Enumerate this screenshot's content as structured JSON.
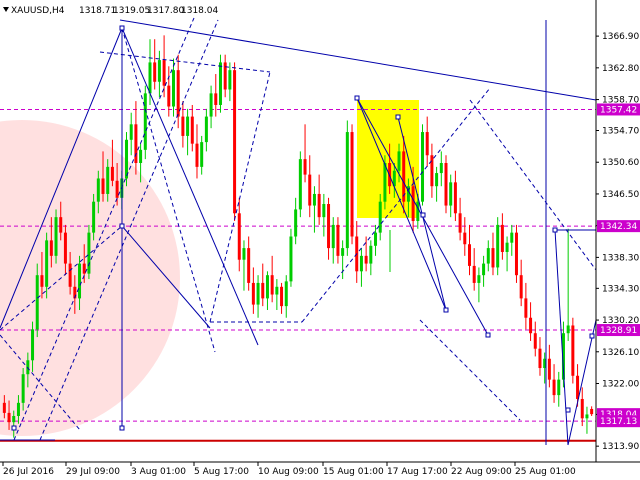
{
  "chart_data": {
    "type": "candlestick",
    "header": {
      "symbol": "XAUUSD,H4",
      "open": "1318.71",
      "high": "1319.05",
      "low": "1317.80",
      "close": "1318.04"
    },
    "ylim": [
      1312.5,
      1369.5
    ],
    "y_ticks": [
      "1366.90",
      "1362.80",
      "1358.70",
      "1354.70",
      "1350.60",
      "1346.50",
      "1342.40",
      "1338.30",
      "1334.30",
      "1330.20",
      "1326.10",
      "1322.00",
      "1318.00",
      "1313.90"
    ],
    "x_ticks": [
      "26 Jul 2016",
      "29 Jul 09:00",
      "3 Aug 01:00",
      "5 Aug 17:00",
      "10 Aug 09:00",
      "15 Aug 01:00",
      "17 Aug 17:00",
      "22 Aug 09:00",
      "25 Aug 01:00"
    ],
    "price_labels": [
      {
        "text": "1357.42",
        "value": 1357.42
      },
      {
        "text": "1342.34",
        "value": 1342.34
      },
      {
        "text": "1328.91",
        "value": 1328.91
      },
      {
        "text": "1318.04",
        "value": 1318.04
      },
      {
        "text": "1317.13",
        "value": 1317.13
      }
    ],
    "levels": [
      {
        "value": 1357.42,
        "color": "#cc00cc",
        "style": "dashed"
      },
      {
        "value": 1342.34,
        "color": "#cc00cc",
        "style": "dashed"
      },
      {
        "value": 1328.91,
        "color": "#cc00cc",
        "style": "dashed"
      },
      {
        "value": 1317.13,
        "color": "#cc00cc",
        "style": "dashed"
      },
      {
        "value": 1314.6,
        "color": "#cc0000",
        "style": "solid"
      }
    ],
    "colors": {
      "bull": "#00cc00",
      "bear": "#ff0000",
      "trend": "#0000aa",
      "fan": "#0000cc",
      "level": "#cc00cc",
      "highlight": "#ffff00",
      "circle": "#ffd6d6"
    },
    "candles": [
      [
        1319.5,
        1320.5,
        1317.5,
        1318.2
      ],
      [
        1318.2,
        1319.8,
        1316.0,
        1317.0
      ],
      [
        1317.0,
        1318.5,
        1315.0,
        1317.8
      ],
      [
        1317.8,
        1320.5,
        1316.8,
        1319.5
      ],
      [
        1319.5,
        1324.0,
        1318.5,
        1323.2
      ],
      [
        1323.2,
        1326.0,
        1321.5,
        1325.0
      ],
      [
        1325.0,
        1330.0,
        1323.5,
        1329.0
      ],
      [
        1329.0,
        1337.5,
        1328.0,
        1336.0
      ],
      [
        1336.0,
        1339.0,
        1333.0,
        1334.5
      ],
      [
        1334.5,
        1341.5,
        1333.0,
        1340.5
      ],
      [
        1340.5,
        1343.5,
        1337.0,
        1338.5
      ],
      [
        1338.5,
        1344.5,
        1337.5,
        1343.5
      ],
      [
        1343.5,
        1345.5,
        1340.5,
        1341.5
      ],
      [
        1341.5,
        1342.5,
        1336.0,
        1337.5
      ],
      [
        1337.5,
        1339.0,
        1333.5,
        1334.5
      ],
      [
        1334.5,
        1336.0,
        1331.0,
        1333.0
      ],
      [
        1333.0,
        1338.5,
        1331.5,
        1337.5
      ],
      [
        1337.5,
        1340.0,
        1335.0,
        1336.2
      ],
      [
        1336.2,
        1342.5,
        1335.5,
        1341.5
      ],
      [
        1341.5,
        1346.5,
        1340.5,
        1345.5
      ],
      [
        1345.5,
        1349.5,
        1344.0,
        1348.5
      ],
      [
        1348.5,
        1352.0,
        1345.5,
        1346.5
      ],
      [
        1346.5,
        1351.0,
        1345.5,
        1350.0
      ],
      [
        1350.0,
        1353.5,
        1347.5,
        1348.2
      ],
      [
        1348.2,
        1350.5,
        1345.0,
        1346.0
      ],
      [
        1346.0,
        1349.5,
        1344.5,
        1348.5
      ],
      [
        1348.5,
        1354.5,
        1347.5,
        1353.5
      ],
      [
        1353.5,
        1357.0,
        1351.5,
        1355.5
      ],
      [
        1355.5,
        1358.5,
        1349.0,
        1350.5
      ],
      [
        1350.5,
        1353.0,
        1348.0,
        1352.2
      ],
      [
        1352.2,
        1360.5,
        1351.0,
        1359.5
      ],
      [
        1359.5,
        1366.5,
        1358.0,
        1363.5
      ],
      [
        1363.5,
        1366.5,
        1360.0,
        1361.0
      ],
      [
        1361.0,
        1365.0,
        1359.0,
        1363.8
      ],
      [
        1363.8,
        1367.0,
        1359.0,
        1360.5
      ],
      [
        1360.5,
        1363.0,
        1356.5,
        1357.8
      ],
      [
        1357.8,
        1364.0,
        1356.5,
        1362.5
      ],
      [
        1362.5,
        1364.5,
        1355.0,
        1356.5
      ],
      [
        1356.5,
        1358.5,
        1352.5,
        1354.0
      ],
      [
        1354.0,
        1357.5,
        1351.5,
        1356.5
      ],
      [
        1356.5,
        1358.0,
        1352.0,
        1353.0
      ],
      [
        1353.0,
        1355.5,
        1348.5,
        1350.0
      ],
      [
        1350.0,
        1354.0,
        1349.0,
        1353.2
      ],
      [
        1353.2,
        1357.5,
        1352.0,
        1356.5
      ],
      [
        1356.5,
        1360.5,
        1355.0,
        1359.5
      ],
      [
        1359.5,
        1362.0,
        1356.5,
        1358.0
      ],
      [
        1358.0,
        1364.5,
        1357.0,
        1363.5
      ],
      [
        1363.5,
        1364.5,
        1359.0,
        1360.0
      ],
      [
        1360.0,
        1363.5,
        1358.5,
        1362.5
      ],
      [
        1362.5,
        1363.5,
        1343.0,
        1344.0
      ],
      [
        1344.0,
        1346.0,
        1336.5,
        1338.0
      ],
      [
        1338.0,
        1340.5,
        1334.0,
        1339.5
      ],
      [
        1339.5,
        1341.0,
        1334.0,
        1335.0
      ],
      [
        1335.0,
        1337.0,
        1331.0,
        1332.2
      ],
      [
        1332.2,
        1336.0,
        1330.5,
        1335.0
      ],
      [
        1335.0,
        1337.5,
        1332.0,
        1333.0
      ],
      [
        1333.0,
        1336.5,
        1331.5,
        1336.0
      ],
      [
        1336.0,
        1338.5,
        1332.5,
        1333.5
      ],
      [
        1333.5,
        1335.5,
        1331.5,
        1334.5
      ],
      [
        1334.5,
        1335.0,
        1331.0,
        1332.0
      ],
      [
        1332.0,
        1336.0,
        1330.5,
        1335.2
      ],
      [
        1335.2,
        1342.0,
        1334.5,
        1341.0
      ],
      [
        1341.0,
        1346.0,
        1340.0,
        1344.5
      ],
      [
        1344.5,
        1352.0,
        1343.5,
        1351.0
      ],
      [
        1351.0,
        1355.5,
        1348.0,
        1349.0
      ],
      [
        1349.0,
        1351.5,
        1343.5,
        1345.0
      ],
      [
        1345.0,
        1347.5,
        1341.5,
        1346.5
      ],
      [
        1346.5,
        1349.0,
        1342.5,
        1343.5
      ],
      [
        1343.5,
        1346.5,
        1341.0,
        1345.2
      ],
      [
        1345.2,
        1346.0,
        1338.0,
        1339.5
      ],
      [
        1339.5,
        1343.5,
        1337.5,
        1342.5
      ],
      [
        1342.5,
        1343.5,
        1337.5,
        1338.5
      ],
      [
        1338.5,
        1340.5,
        1335.5,
        1339.5
      ],
      [
        1339.5,
        1356.0,
        1338.5,
        1354.5
      ],
      [
        1354.5,
        1355.5,
        1340.0,
        1341.0
      ],
      [
        1341.0,
        1343.0,
        1335.0,
        1336.5
      ],
      [
        1336.5,
        1339.5,
        1334.5,
        1338.5
      ],
      [
        1338.5,
        1341.0,
        1336.5,
        1337.5
      ],
      [
        1337.5,
        1340.5,
        1336.0,
        1339.8
      ],
      [
        1339.8,
        1342.5,
        1338.5,
        1341.5
      ],
      [
        1341.5,
        1346.5,
        1340.5,
        1345.5
      ],
      [
        1345.5,
        1351.5,
        1344.5,
        1350.5
      ],
      [
        1350.5,
        1353.0,
        1346.5,
        1347.5
      ],
      [
        1347.5,
        1350.5,
        1346.0,
        1349.5
      ],
      [
        1349.5,
        1353.0,
        1348.0,
        1352.0
      ],
      [
        1352.0,
        1354.0,
        1344.0,
        1345.5
      ],
      [
        1345.5,
        1348.5,
        1343.5,
        1347.5
      ],
      [
        1347.5,
        1350.0,
        1341.5,
        1343.0
      ],
      [
        1343.0,
        1346.5,
        1342.0,
        1345.5
      ],
      [
        1345.5,
        1355.5,
        1345.0,
        1354.5
      ],
      [
        1354.5,
        1356.5,
        1350.0,
        1351.5
      ],
      [
        1351.5,
        1353.0,
        1346.0,
        1347.5
      ],
      [
        1347.5,
        1350.0,
        1345.5,
        1349.2
      ],
      [
        1349.2,
        1352.0,
        1347.5,
        1350.5
      ],
      [
        1350.5,
        1351.5,
        1344.0,
        1345.0
      ],
      [
        1345.0,
        1349.0,
        1343.5,
        1348.0
      ],
      [
        1348.0,
        1349.5,
        1343.0,
        1344.0
      ],
      [
        1344.0,
        1346.0,
        1340.5,
        1341.5
      ],
      [
        1341.5,
        1343.5,
        1338.5,
        1340.0
      ],
      [
        1340.0,
        1342.5,
        1336.0,
        1337.2
      ],
      [
        1337.2,
        1339.5,
        1334.0,
        1335.0
      ],
      [
        1335.0,
        1337.0,
        1332.5,
        1336.0
      ],
      [
        1336.0,
        1338.5,
        1334.5,
        1337.5
      ],
      [
        1337.5,
        1340.5,
        1336.5,
        1339.5
      ],
      [
        1339.5,
        1341.5,
        1336.0,
        1337.0
      ],
      [
        1337.0,
        1343.5,
        1336.0,
        1342.5
      ],
      [
        1342.5,
        1344.0,
        1338.0,
        1339.0
      ],
      [
        1339.0,
        1341.0,
        1336.5,
        1340.2
      ],
      [
        1340.2,
        1342.5,
        1338.5,
        1341.5
      ],
      [
        1341.5,
        1342.5,
        1335.0,
        1336.0
      ],
      [
        1336.0,
        1338.0,
        1332.0,
        1333.0
      ],
      [
        1333.0,
        1335.0,
        1329.0,
        1330.5
      ],
      [
        1330.5,
        1332.5,
        1327.5,
        1328.5
      ],
      [
        1328.5,
        1330.0,
        1325.5,
        1326.5
      ],
      [
        1326.5,
        1328.0,
        1323.0,
        1324.0
      ],
      [
        1324.0,
        1326.0,
        1322.0,
        1325.2
      ],
      [
        1325.2,
        1327.0,
        1321.5,
        1322.5
      ],
      [
        1322.5,
        1324.5,
        1319.5,
        1320.5
      ],
      [
        1320.5,
        1323.5,
        1319.0,
        1322.5
      ],
      [
        1322.5,
        1330.0,
        1321.5,
        1328.5
      ],
      [
        1328.5,
        1342.0,
        1327.5,
        1329.5
      ],
      [
        1329.5,
        1330.5,
        1322.0,
        1323.0
      ],
      [
        1323.0,
        1324.5,
        1319.0,
        1320.0
      ],
      [
        1320.0,
        1321.5,
        1316.5,
        1317.5
      ],
      [
        1317.5,
        1319.0,
        1315.5,
        1318.0
      ],
      [
        1318.71,
        1319.05,
        1317.8,
        1318.04
      ]
    ]
  }
}
